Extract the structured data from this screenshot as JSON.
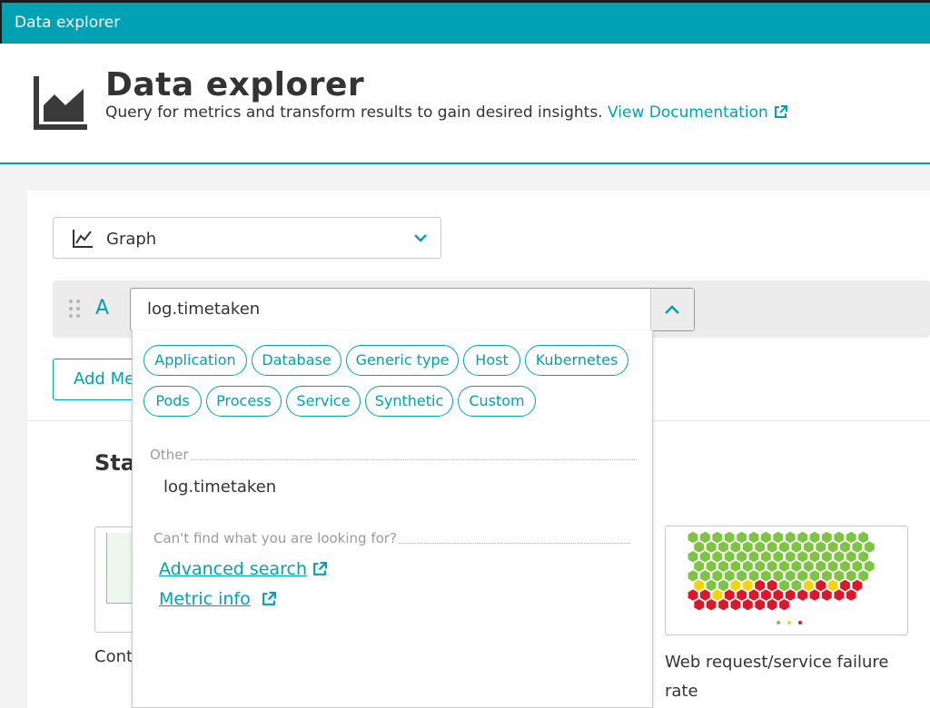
{
  "topbar": {
    "title": "Data explorer"
  },
  "header": {
    "title": "Data explorer",
    "subtitle": "Query for metrics and transform results to gain desired insights.",
    "doc_link": "View Documentation"
  },
  "visualization_select": {
    "value": "Graph",
    "icon": "line-graph-icon"
  },
  "query": {
    "letter": "A",
    "metric_value": "log.timetaken",
    "add_metric_label": "Add Me"
  },
  "dropdown": {
    "chips": [
      "Application",
      "Database",
      "Generic type",
      "Host",
      "Kubernetes",
      "Pods",
      "Process",
      "Service",
      "Synthetic",
      "Custom"
    ],
    "other_label": "Other",
    "other_option": "log.timetaken",
    "help_label": "Can't find what you are looking for?",
    "advanced_search": "Advanced search",
    "metric_info": "Metric info"
  },
  "background": {
    "heading_partial": "Sta",
    "card_left_label_partial": "Cont",
    "card_right_label": "Web request/service failure rate"
  },
  "colors": {
    "accent": "#00a1b2",
    "hex_green": "#7dc540",
    "hex_yellow": "#f5d30f",
    "hex_red": "#dc172a"
  }
}
